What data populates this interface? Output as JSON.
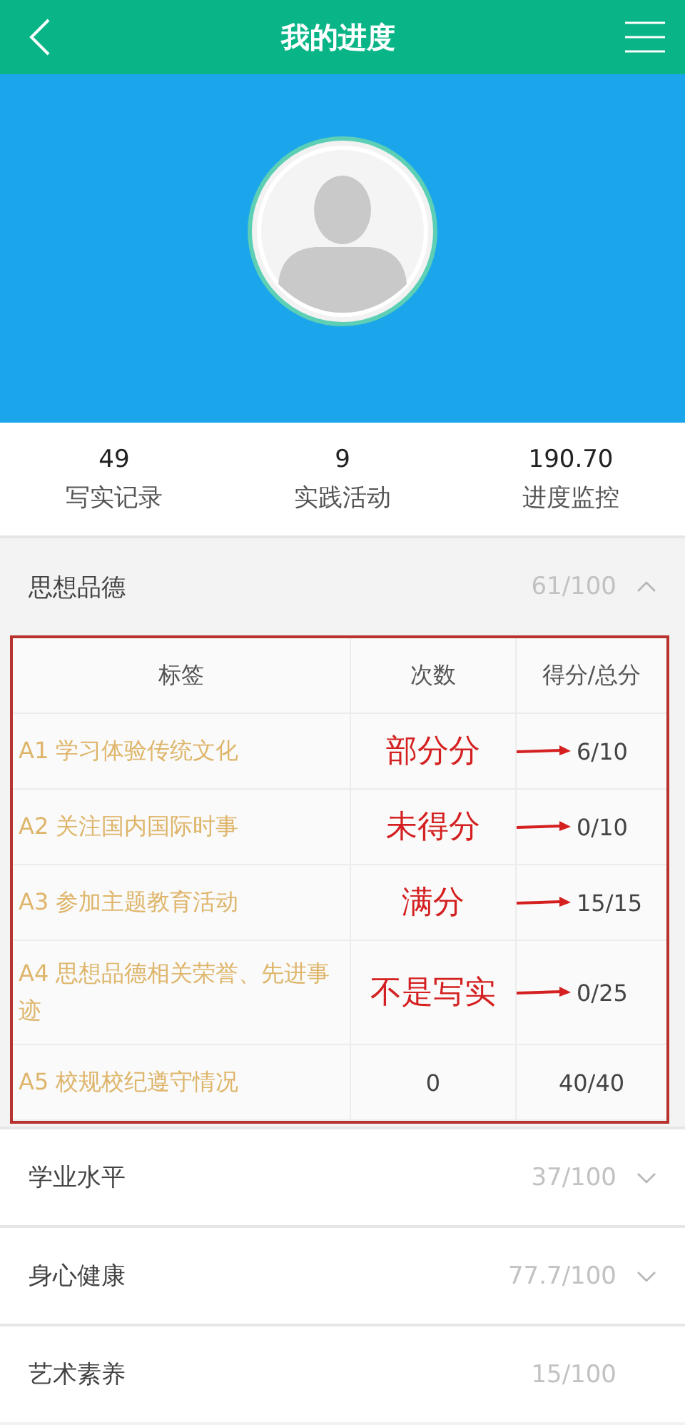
{
  "header": {
    "title": "我的进度"
  },
  "stats": [
    {
      "value": "49",
      "label": "写实记录"
    },
    {
      "value": "9",
      "label": "实践活动"
    },
    {
      "value": "190.70",
      "label": "进度监控"
    }
  ],
  "sections": [
    {
      "name": "思想品德",
      "score": "61/100",
      "expanded": true,
      "table": {
        "columns": [
          "标签",
          "次数",
          "得分/总分"
        ],
        "rows": [
          {
            "label": "A1 学习体验传统文化",
            "note": "部分分",
            "score": "6/10"
          },
          {
            "label": "A2 关注国内国际时事",
            "note": "未得分",
            "score": "0/10"
          },
          {
            "label": "A3 参加主题教育活动",
            "note": "满分",
            "score": "15/15"
          },
          {
            "label": "A4 思想品德相关荣誉、先进事迹",
            "note": "不是写实",
            "score": "0/25"
          },
          {
            "label": "A5 校规校纪遵守情况",
            "count": "0",
            "score": "40/40"
          }
        ]
      }
    },
    {
      "name": "学业水平",
      "score": "37/100",
      "expanded": false
    },
    {
      "name": "身心健康",
      "score": "77.7/100",
      "expanded": false
    },
    {
      "name": "艺术素养",
      "score": "15/100"
    }
  ]
}
